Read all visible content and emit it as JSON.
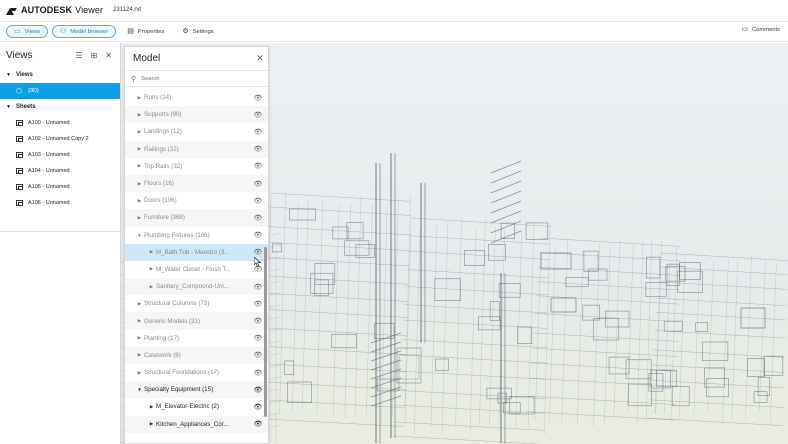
{
  "app": {
    "brand": "AUTODESK",
    "product": "Viewer",
    "filename": "231124.rvt"
  },
  "toolbar": {
    "items": [
      {
        "label": "Views",
        "icon": "views-icon",
        "active": true
      },
      {
        "label": "Model browser",
        "icon": "model-browser-icon",
        "active": true
      },
      {
        "label": "Properties",
        "icon": "properties-icon",
        "active": false
      },
      {
        "label": "Settings",
        "icon": "gear-icon",
        "active": false
      }
    ],
    "comments_label": "Comments"
  },
  "views_panel": {
    "title": "Views",
    "sections": [
      {
        "label": "Views",
        "items": [
          {
            "label": "{3D}",
            "selected": true
          }
        ]
      },
      {
        "label": "Sheets",
        "items": [
          {
            "label": "A100 - Unnamed"
          },
          {
            "label": "A102 - Unnamed Copy 2"
          },
          {
            "label": "A103 - Unnamed"
          },
          {
            "label": "A104 - Unnamed"
          },
          {
            "label": "A105 - Unnamed"
          },
          {
            "label": "A106 - Unnamed"
          }
        ]
      }
    ]
  },
  "model_panel": {
    "title": "Model",
    "search_placeholder": "Search",
    "rows": [
      {
        "label": "Runs (24)"
      },
      {
        "label": "Supports (90)"
      },
      {
        "label": "Landings (12)"
      },
      {
        "label": "Railings (32)"
      },
      {
        "label": "Top Rails (32)"
      },
      {
        "label": "Floors (16)"
      },
      {
        "label": "Doors (106)"
      },
      {
        "label": "Furniture (368)"
      },
      {
        "label": "Plumbing Fixtures (106)"
      },
      {
        "label": "M_Bath Tub - Maestro (3..."
      },
      {
        "label": "M_Water Closet - Flush T..."
      },
      {
        "label": "Sanitary_Compound-Uni..."
      },
      {
        "label": "Structural Columns (73)"
      },
      {
        "label": "Generic Models (31)"
      },
      {
        "label": "Planting (17)"
      },
      {
        "label": "Casework (8)"
      },
      {
        "label": "Structural Foundations (17)"
      },
      {
        "label": "Specialty Equipment (15)"
      },
      {
        "label": "M_Elevator-Electric (2)"
      },
      {
        "label": "Kitchen_Appliances_Cor..."
      }
    ]
  }
}
